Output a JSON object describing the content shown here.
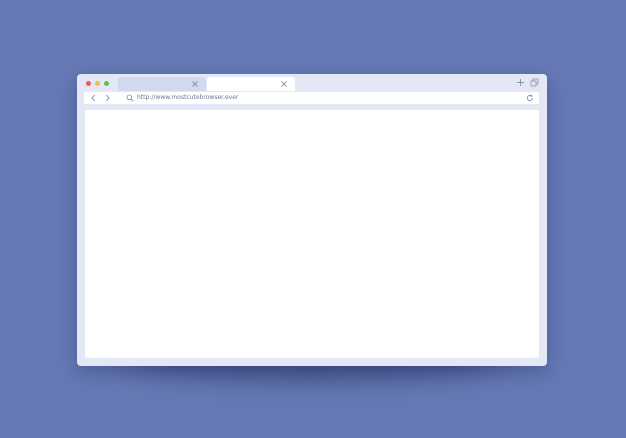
{
  "address_bar": {
    "url": "http://www.mostcutebrowser.ever"
  },
  "window_controls": {
    "close_color": "#ee5a52",
    "minimize_color": "#f4be3a",
    "maximize_color": "#5cc14f"
  },
  "tabs": [
    {
      "state": "inactive",
      "icon": "close-icon"
    },
    {
      "state": "active",
      "icon": "close-icon"
    }
  ],
  "toolbar_icons": [
    "chevron-left-icon",
    "chevron-right-icon",
    "search-icon",
    "reload-icon",
    "plus-icon",
    "restore-window-icon"
  ],
  "colors": {
    "background": "#6679b5",
    "window_frame": "#e3e7f6",
    "content": "#ffffff"
  }
}
